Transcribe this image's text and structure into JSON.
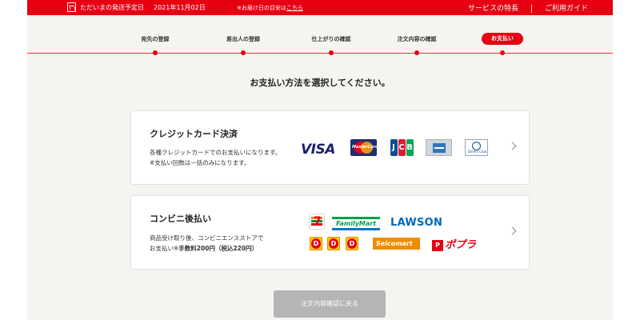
{
  "header": {
    "ship_label": "ただいまの発送予定日",
    "ship_date": "2021年11月02日",
    "note_prefix": "※お届け日の目安は",
    "note_link": "こちら",
    "nav": [
      "サービスの特長",
      "ご利用ガイド"
    ],
    "accent_color": "#e60012"
  },
  "stepper": {
    "steps": [
      "宛先の登録",
      "差出人の登録",
      "仕上がりの確認",
      "注文内容の確認",
      "お支払い"
    ],
    "active_index": 4
  },
  "heading": "お支払い方法を選択してください。",
  "payment_methods": [
    {
      "title": "クレジットカード決済",
      "desc_lines": [
        "各種クレジットカードでのお支払いになります。",
        "※支払い回数は一括のみになります。"
      ],
      "brands": {
        "visa": "VISA",
        "mastercard": "MasterCard",
        "jcb": [
          "J",
          "C",
          "B"
        ],
        "amex": "american-express-icon",
        "diners": "Diners Club"
      }
    },
    {
      "title": "コンビニ後払い",
      "desc_line1": "商品受け取り後、コンビニエンスストアで",
      "desc_line2_prefix": "お支払い※",
      "desc_line2_bold": "手数料200円（税込220円）",
      "stores": {
        "seven_eleven": "7",
        "familymart": "FamilyMart",
        "lawson": "LAWSON",
        "daily_yamazaki": "D",
        "seicomart": "Seicomart",
        "poplar_mark": "P",
        "poplar": "ポプラ"
      }
    }
  ],
  "back_button": "注文内容確認に戻る"
}
